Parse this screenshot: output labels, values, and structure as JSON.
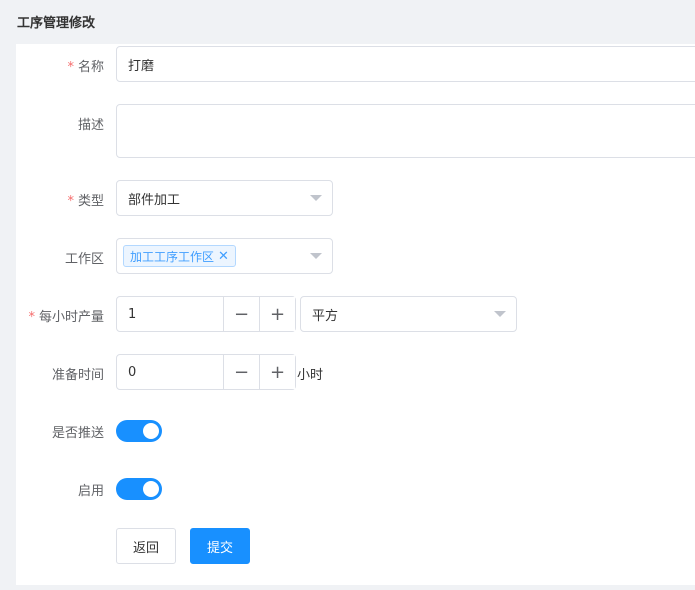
{
  "page": {
    "title": "工序管理修改"
  },
  "form": {
    "name": {
      "label": "名称",
      "value": "打磨",
      "required": true
    },
    "description": {
      "label": "描述",
      "value": ""
    },
    "type": {
      "label": "类型",
      "value": "部件加工",
      "required": true
    },
    "workarea": {
      "label": "工作区",
      "tag": "加工工序工作区"
    },
    "output": {
      "label": "每小时产量",
      "value": "1",
      "unit": "平方",
      "required": true
    },
    "prep": {
      "label": "准备时间",
      "value": "0",
      "unit": "小时"
    },
    "push": {
      "label": "是否推送",
      "on": true
    },
    "enabled": {
      "label": "启用",
      "on": true
    }
  },
  "actions": {
    "back_label": "返回",
    "submit_label": "提交"
  },
  "colors": {
    "primary": "#1890ff",
    "required": "#f56c6c",
    "tag_text": "#409eff"
  },
  "icons": {
    "minus": "minus-icon",
    "plus": "plus-icon",
    "tag_close": "close-icon",
    "select_arrow": "chevron-down-icon"
  }
}
